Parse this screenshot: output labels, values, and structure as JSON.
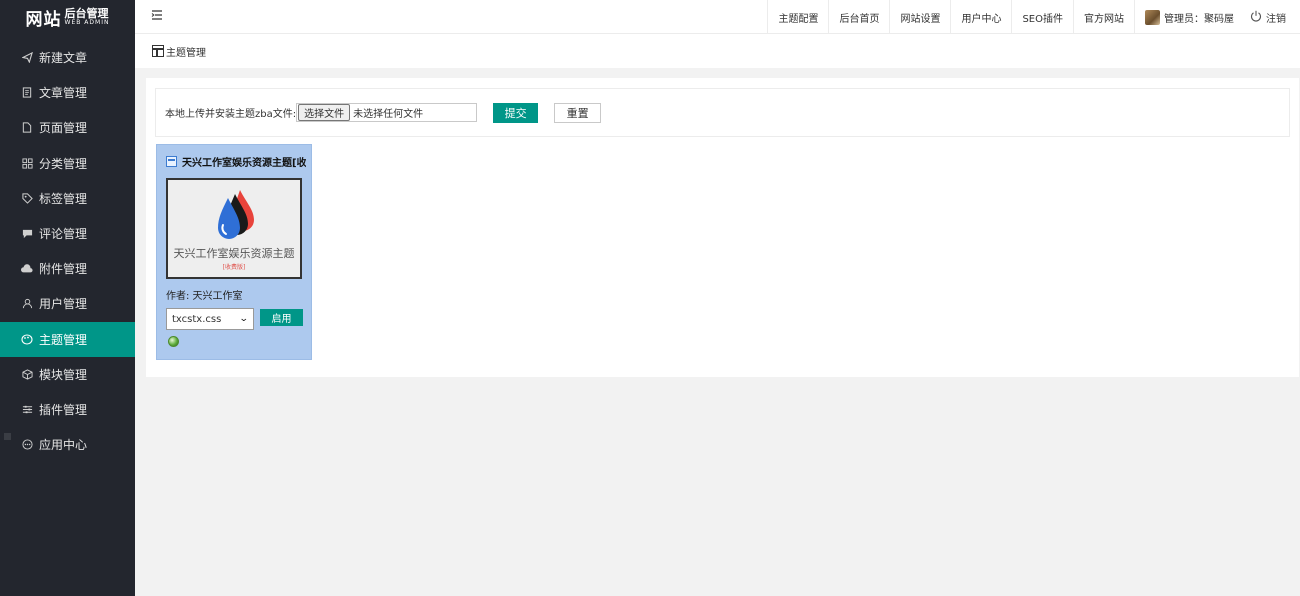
{
  "sidebar": {
    "logo": {
      "main": "网站",
      "side_top": "后台管理",
      "side_bottom": "WEB ADMIN"
    },
    "items": [
      {
        "label": "新建文章",
        "icon": "send-icon"
      },
      {
        "label": "文章管理",
        "icon": "document-icon"
      },
      {
        "label": "页面管理",
        "icon": "page-icon"
      },
      {
        "label": "分类管理",
        "icon": "category-icon"
      },
      {
        "label": "标签管理",
        "icon": "tag-icon"
      },
      {
        "label": "评论管理",
        "icon": "comment-icon"
      },
      {
        "label": "附件管理",
        "icon": "cloud-upload-icon"
      },
      {
        "label": "用户管理",
        "icon": "user-icon"
      },
      {
        "label": "主题管理",
        "icon": "palette-icon",
        "active": true
      },
      {
        "label": "模块管理",
        "icon": "cube-icon"
      },
      {
        "label": "插件管理",
        "icon": "sliders-icon"
      },
      {
        "label": "应用中心",
        "icon": "app-center-icon"
      }
    ]
  },
  "topbar": {
    "menu": [
      "主题配置",
      "后台首页",
      "网站设置",
      "用户中心",
      "SEO插件",
      "官方网站"
    ],
    "user": "管理员：聚码屋",
    "logout": "注销"
  },
  "breadcrumb": {
    "title": "主题管理"
  },
  "upload": {
    "label": "本地上传并安装主题zba文件:",
    "choose_button": "选择文件",
    "no_file": "未选择任何文件",
    "submit": "提交",
    "reset": "重置"
  },
  "theme_card": {
    "title": "天兴工作室娱乐资源主题[收费",
    "thumbnail_name": "天兴工作室娱乐资源主题",
    "thumbnail_tag": "[收费版]",
    "author": "作者: 天兴工作室",
    "style_select": "txcstx.css",
    "enable_button": "启用"
  },
  "colors": {
    "accent": "#009688",
    "sidebar": "#23262e",
    "card": "#adc9ee"
  }
}
